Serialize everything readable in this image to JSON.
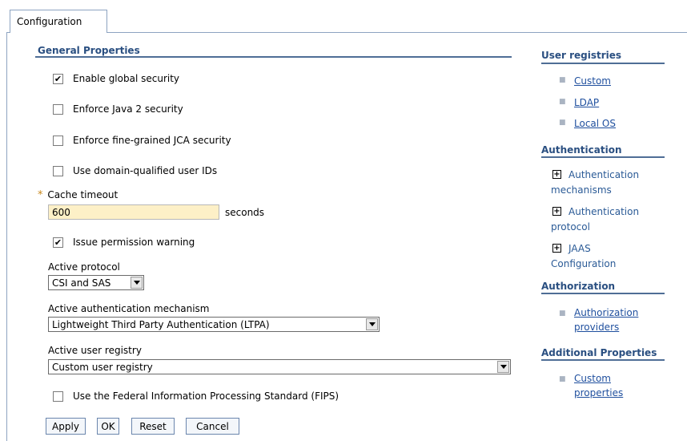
{
  "tab": {
    "label": "Configuration"
  },
  "general": {
    "title": "General Properties",
    "enable_global_security": {
      "label": "Enable global security",
      "checked": true
    },
    "enforce_java2": {
      "label": "Enforce Java 2 security",
      "checked": false
    },
    "enforce_jca": {
      "label": "Enforce fine-grained JCA security",
      "checked": false
    },
    "domain_qualified": {
      "label": "Use domain-qualified user IDs",
      "checked": false
    },
    "cache_timeout": {
      "label": "Cache timeout",
      "value": "600",
      "units": "seconds",
      "required_marker": "*"
    },
    "issue_permission_warning": {
      "label": "Issue permission warning",
      "checked": true
    },
    "active_protocol": {
      "label": "Active protocol",
      "value": "CSI and SAS"
    },
    "active_auth_mechanism": {
      "label": "Active authentication mechanism",
      "value": "Lightweight Third Party Authentication (LTPA)"
    },
    "active_user_registry": {
      "label": "Active user registry",
      "value": "Custom user registry"
    },
    "fips": {
      "label": "Use the Federal Information Processing Standard (FIPS)",
      "checked": false
    }
  },
  "buttons": {
    "apply": "Apply",
    "ok": "OK",
    "reset": "Reset",
    "cancel": "Cancel"
  },
  "sidebar": {
    "user_registries": {
      "title": "User registries",
      "items": [
        "Custom",
        "LDAP",
        "Local OS"
      ]
    },
    "authentication": {
      "title": "Authentication",
      "items": [
        "Authentication mechanisms",
        "Authentication protocol",
        "JAAS Configuration"
      ]
    },
    "authorization": {
      "title": "Authorization",
      "items": [
        "Authorization providers"
      ]
    },
    "additional": {
      "title": "Additional Properties",
      "items": [
        "Custom properties"
      ]
    }
  },
  "colors": {
    "heading": "#2a4f81",
    "link": "#1f4f9e",
    "input_bg": "#fdf0c7",
    "rule": "#4f6e96"
  }
}
